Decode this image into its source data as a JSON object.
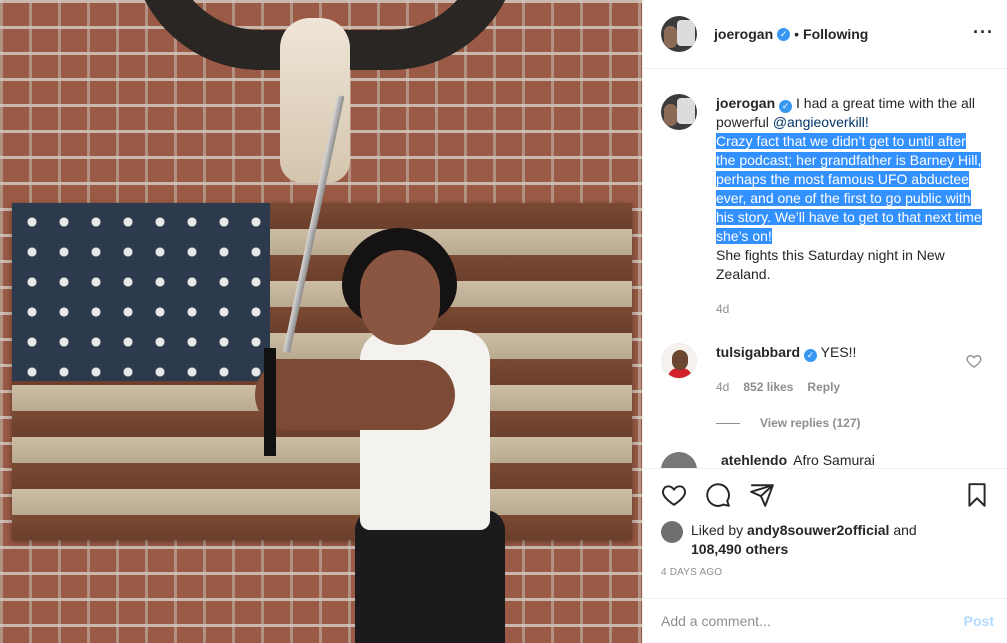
{
  "post": {
    "author": "joerogan",
    "header_separator": "•",
    "follow_status": "Following",
    "more_icon": "ellipsis-icon",
    "caption": {
      "author": "joerogan",
      "intro": "I had a great time with the all powerful ",
      "mention": "@angieoverkill!",
      "highlighted": "Crazy fact that we didn’t get to until after the podcast; her grandfather is Barney Hill, perhaps the most famous UFO abductee ever, and one of the first to go public with his story. We’ll have to get to that next time she’s on!",
      "outro": "She fights this Saturday night in New Zealand.",
      "age": "4d"
    },
    "comments": [
      {
        "author": "tulsigabbard",
        "text": "YES!!",
        "age": "4d",
        "likes": "852 likes",
        "reply_label": "Reply",
        "view_replies": "View replies (127)"
      }
    ],
    "partial_comment": {
      "author": "atehlendo",
      "text": "Afro Samurai"
    },
    "likes": {
      "prefix": "Liked by ",
      "user": "andy8souwer2official",
      "middle": " and",
      "others": "108,490 others"
    },
    "date": "4 DAYS AGO",
    "add_comment_placeholder": "Add a comment...",
    "post_button": "Post"
  },
  "colors": {
    "verified": "#3897f0",
    "highlight": "#3390ff",
    "post_disabled": "#b3dbff",
    "muted": "#8e8e8e"
  }
}
